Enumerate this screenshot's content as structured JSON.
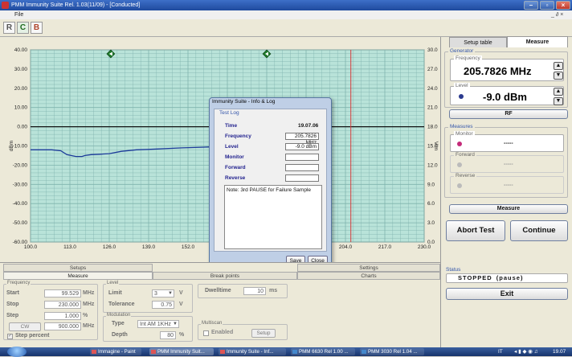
{
  "window": {
    "title": "PMM Immunity Suite  Rel. 1.03(11/09) - [Conducted]",
    "menu_file": "File",
    "mdi_controls": "_ ∂ ×"
  },
  "toolbar": {
    "buttons": [
      "R",
      "C",
      "B"
    ]
  },
  "chart": {
    "ylabel_left": "dBm",
    "ylabel_right": "V/m",
    "y_left_ticks": [
      "40.00",
      "30.00",
      "20.00",
      "10.00",
      "0.00",
      "-10.00",
      "-20.00",
      "-30.00",
      "-40.00",
      "-50.00",
      "-60.00"
    ],
    "y_right_ticks": [
      "30.0",
      "27.0",
      "24.0",
      "21.0",
      "18.0",
      "15.0",
      "12.0",
      "9.0",
      "6.0",
      "3.0",
      "0.0"
    ],
    "x_ticks": [
      "100.0",
      "113.0",
      "126.0",
      "139.0",
      "152.0",
      "165.0",
      "178.0",
      "191.0",
      "204.0",
      "217.0",
      "230.0"
    ]
  },
  "chart_data": {
    "type": "line",
    "xlim": [
      100,
      230
    ],
    "ylim": [
      -60,
      40
    ],
    "y2lim": [
      0,
      30
    ],
    "ylabel": "dBm",
    "y2label": "V/m",
    "grid": true,
    "series": [
      {
        "x": [
          100,
          107,
          110,
          112,
          114,
          115,
          117,
          118,
          120,
          123,
          126,
          130,
          135,
          139,
          150,
          160,
          170,
          180,
          190,
          199
        ],
        "y": [
          -12,
          -12,
          -12.5,
          -14.5,
          -15.2,
          -15.5,
          -15.5,
          -15,
          -14.5,
          -14.3,
          -14,
          -12.8,
          -12,
          -11.8,
          -11,
          -10.5,
          -10,
          -9.5,
          -9.2,
          -9
        ]
      }
    ],
    "reference_line_y": 0,
    "marker_line_x": 205.78,
    "top_markers_x": [
      126.5,
      178.0
    ]
  },
  "right_panel": {
    "tabs": [
      "Setup table",
      "Measure"
    ],
    "generator_label": "Generator",
    "frequency_label": "Frequency",
    "frequency_value": "205.7826 MHz",
    "level_label": "Level",
    "level_value": "-9.0 dBm",
    "rf_button": "RF",
    "measures_label": "Measures",
    "monitor_label": "Monitor",
    "monitor_value": "-----",
    "forward_label": "Forward",
    "forward_value": "-----",
    "reverse_label": "Reverse",
    "reverse_value": "-----",
    "measure_button": "Measure",
    "abort_button": "Abort Test",
    "continue_button": "Continue",
    "status_label": "Status",
    "status_value": "STOPPED  (pause)",
    "exit_button": "Exit"
  },
  "dialog": {
    "title": "Immunity Suite - Info & Log",
    "group": "Test Log",
    "time_label": "Time",
    "time_value": "19.07.06",
    "frequency_label": "Frequency",
    "frequency_value": "205.7826 MHz",
    "level_label": "Level",
    "level_value": "-9.0 dBm",
    "monitor_label": "Monitor",
    "monitor_value": "",
    "forward_label": "Forward",
    "forward_value": "",
    "reverse_label": "Reverse",
    "reverse_value": "",
    "note": "Note: 3rd PAUSE for Failure Sample",
    "save_button": "Save",
    "close_button": "Close"
  },
  "bottom": {
    "tabs_row1": [
      "Setups",
      "Settings"
    ],
    "tabs_row2": [
      "Measure",
      "Break points",
      "Charts"
    ],
    "frequency_group": "Frequency",
    "start_label": "Start",
    "start_value": "99.529",
    "start_unit": "MHz",
    "stop_label": "Stop",
    "stop_value": "230.000",
    "stop_unit": "MHz",
    "step_label": "Step",
    "step_value": "1.000",
    "step_unit": "%",
    "cw_button": "CW",
    "cw_value": "900.000",
    "cw_unit": "MHz",
    "step_percent_label": "Step percent",
    "level_group": "Level",
    "limit_label": "Limit",
    "limit_value": "3",
    "limit_unit": "V",
    "tolerance_label": "Tolerance",
    "tolerance_value": "0.75",
    "tolerance_unit": "V",
    "modulation_group": "Modulation",
    "type_label": "Type",
    "type_value": "Int AM 1KHz",
    "depth_label": "Depth",
    "depth_value": "80",
    "depth_unit": "%",
    "dwelltime_label": "Dwelltime",
    "dwelltime_value": "10",
    "dwelltime_unit": "ms",
    "multiscan_group": "Multiscan",
    "enabled_label": "Enabled",
    "setup_button": "Setup"
  },
  "taskbar": {
    "tasks": [
      "Immagine - Paint",
      "PMM Immunity Suit...",
      "Immunity Suite - Inf...",
      "PMM 6630 Rel 1.00 ...",
      "PMM 3030 Rel 1.04 ..."
    ],
    "lang": "IT",
    "clock": "19.07"
  }
}
